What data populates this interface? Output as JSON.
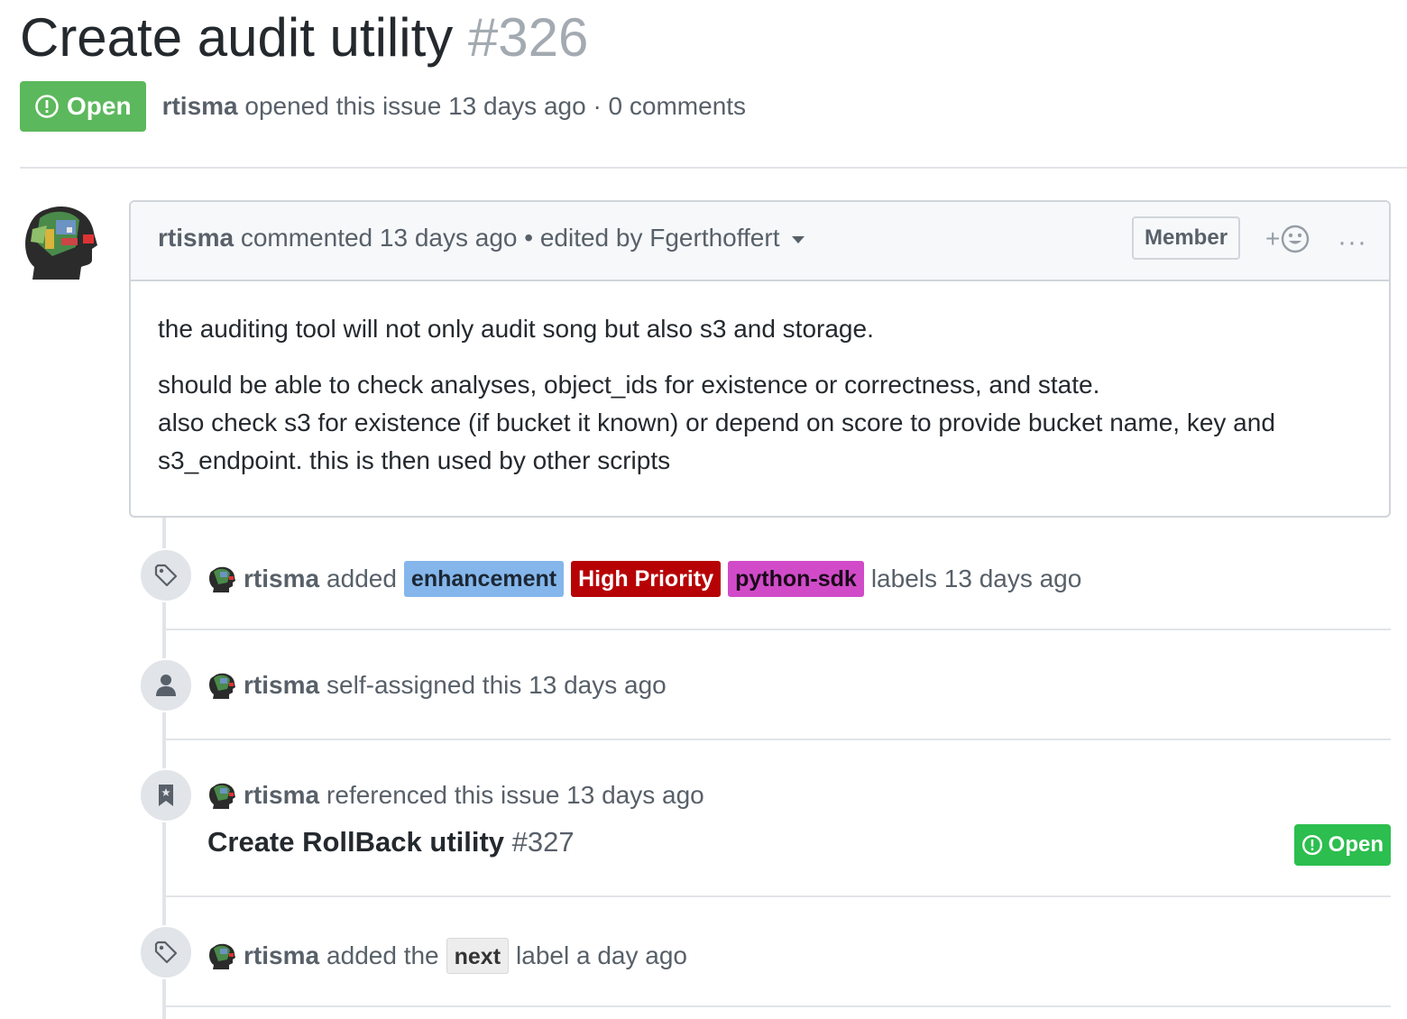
{
  "issue": {
    "title": "Create audit utility",
    "number": "#326",
    "state": "Open",
    "author": "rtisma",
    "opened_text": "opened this issue 13 days ago · 0 comments"
  },
  "comment": {
    "author": "rtisma",
    "header_text": "commented 13 days ago • edited by Fgerthoffert",
    "role_badge": "Member",
    "reaction_plus": "+",
    "more": "···",
    "body": [
      "the auditing tool will not only audit song but also s3 and storage.",
      "should be able to check analyses, object_ids for existence or correctness, and state.",
      "also check s3 for existence (if bucket it known) or depend on score to provide bucket name, key and s3_endpoint. this is then used by other scripts"
    ]
  },
  "events": [
    {
      "icon": "tag-icon",
      "author": "rtisma",
      "action": "added",
      "labels": [
        {
          "text": "enhancement",
          "bg": "#84b6eb",
          "fg": "#1c2733"
        },
        {
          "text": "High Priority",
          "bg": "#b60205",
          "fg": "#ffffff"
        },
        {
          "text": "python-sdk",
          "bg": "#d14bc9",
          "fg": "#1a0a19"
        }
      ],
      "suffix": "labels 13 days ago"
    },
    {
      "icon": "person-icon",
      "author": "rtisma",
      "action": "self-assigned this 13 days ago"
    },
    {
      "icon": "bookmark-icon",
      "author": "rtisma",
      "action": "referenced this issue 13 days ago",
      "ref_title": "Create RollBack utility",
      "ref_number": "#327",
      "ref_state": "Open"
    },
    {
      "icon": "tag-icon",
      "author": "rtisma",
      "action": "added the",
      "labels": [
        {
          "text": "next",
          "bg": "#ededed",
          "fg": "#333333"
        }
      ],
      "suffix": "label a day ago"
    }
  ],
  "colors": {
    "open_green": "#2cbe4e",
    "badge_green": "#5cb85c",
    "border": "#d1d5da",
    "muted_text": "#586069"
  }
}
